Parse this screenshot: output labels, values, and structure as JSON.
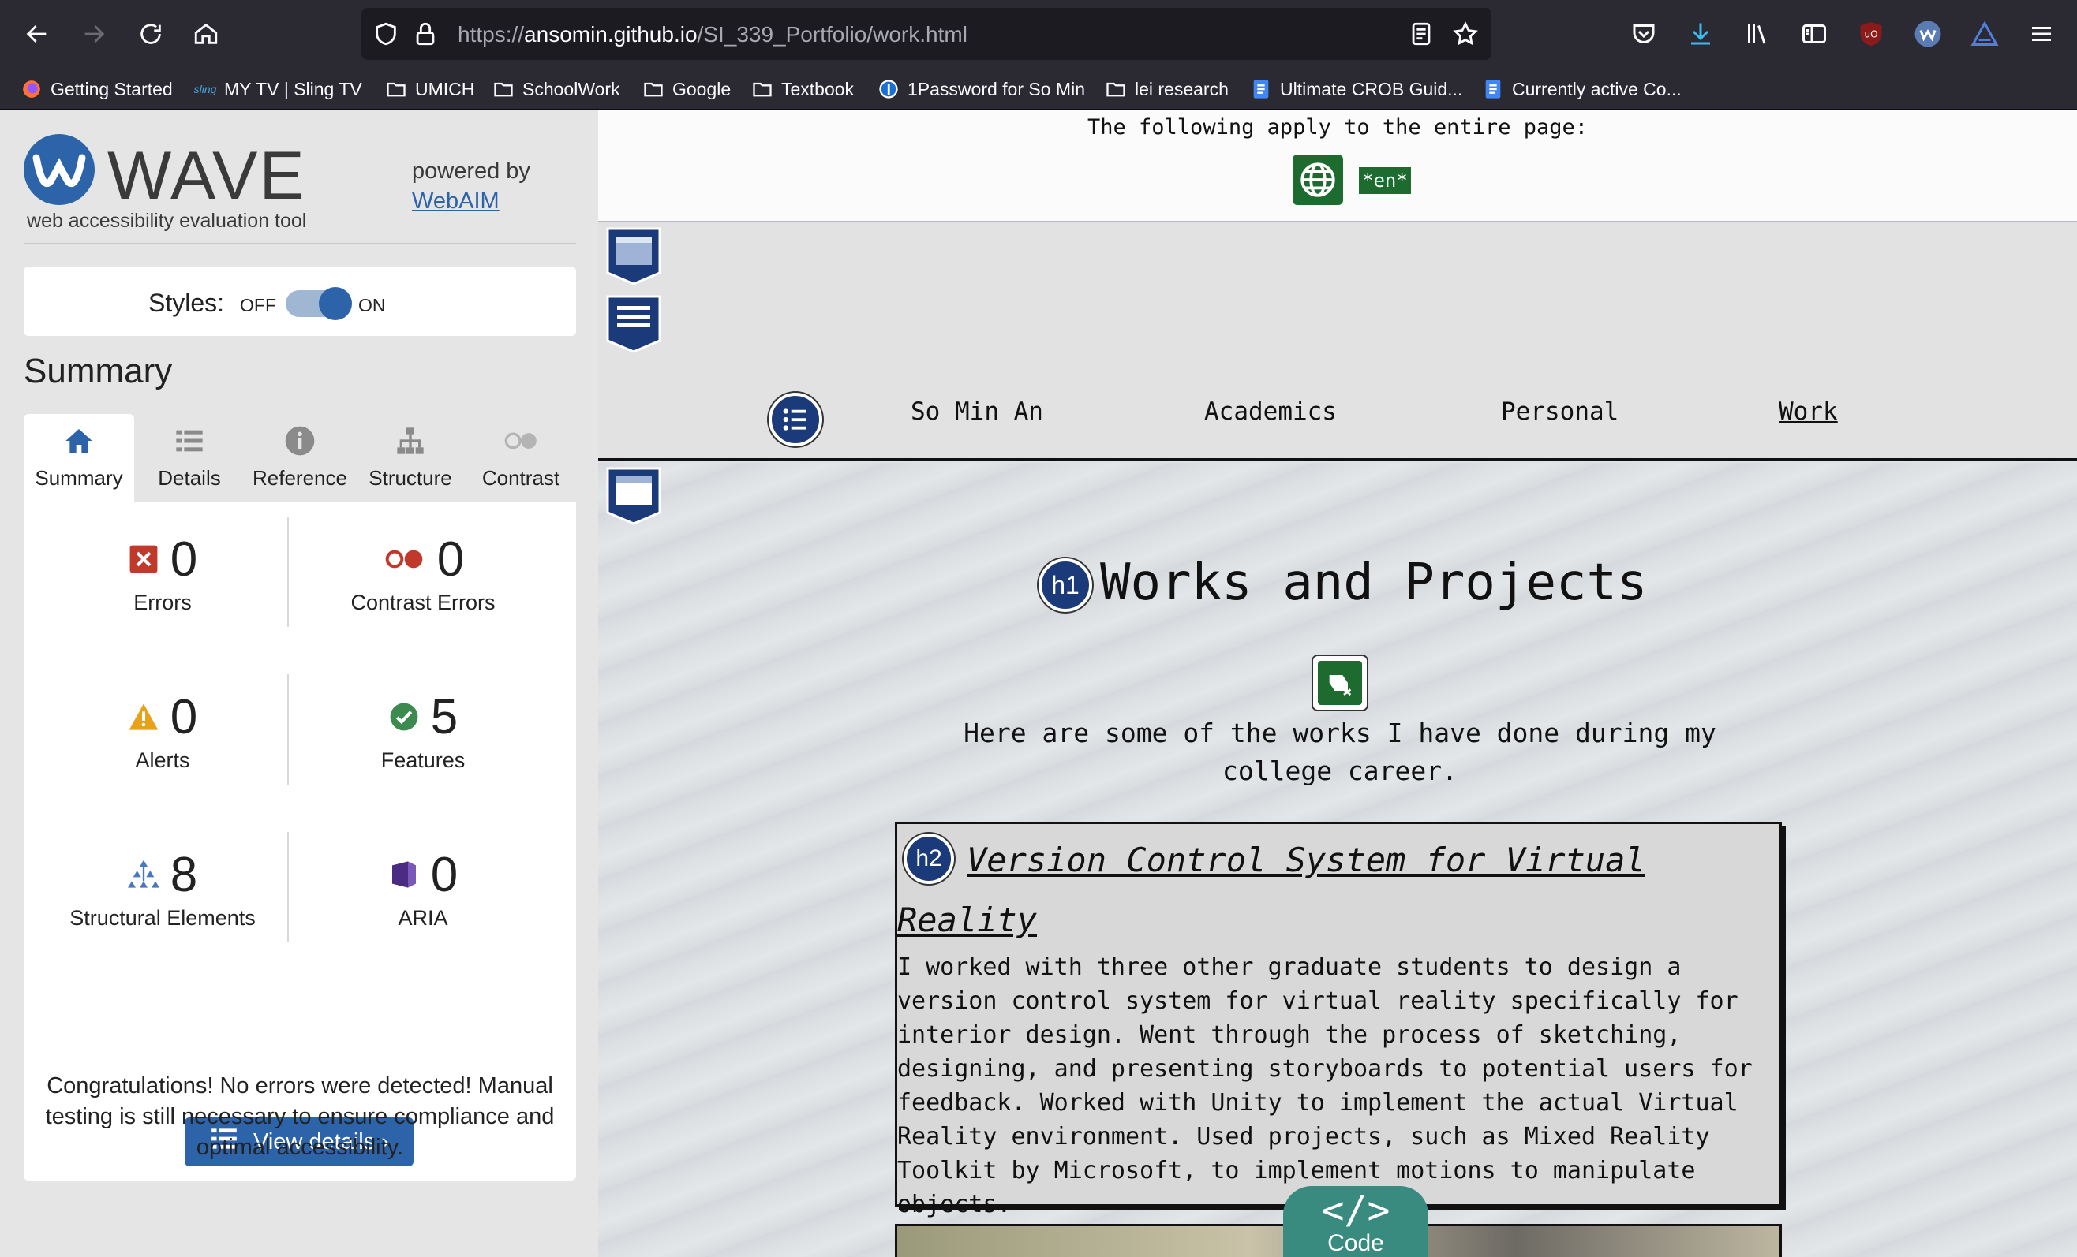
{
  "browser": {
    "url_prefix": "https://",
    "url_host": "ansomin.github.io",
    "url_path": "/SI_339_Portfolio/work.html",
    "bookmarks": [
      {
        "label": "Getting Started",
        "icon": "firefox-icon"
      },
      {
        "label": "MY TV | Sling TV",
        "icon": "sling-icon"
      },
      {
        "label": "UMICH",
        "icon": "folder-icon"
      },
      {
        "label": "SchoolWork",
        "icon": "folder-icon"
      },
      {
        "label": "Google",
        "icon": "folder-icon"
      },
      {
        "label": "Textbook",
        "icon": "folder-icon"
      },
      {
        "label": "1Password for So Min",
        "icon": "1password-icon"
      },
      {
        "label": "lei research",
        "icon": "folder-icon"
      },
      {
        "label": "Ultimate CROB Guid...",
        "icon": "doc-icon"
      },
      {
        "label": "Currently active Co...",
        "icon": "doc-icon"
      }
    ]
  },
  "wave": {
    "title": "WAVE",
    "subtitle": "web accessibility evaluation tool",
    "powered_by": "powered by",
    "powered_link": "WebAIM",
    "styles_label": "Styles:",
    "styles_off": "OFF",
    "styles_on": "ON",
    "summary_heading": "Summary",
    "tabs": [
      {
        "label": "Summary",
        "icon": "home-icon"
      },
      {
        "label": "Details",
        "icon": "list-icon"
      },
      {
        "label": "Reference",
        "icon": "info-icon"
      },
      {
        "label": "Structure",
        "icon": "hierarchy-icon"
      },
      {
        "label": "Contrast",
        "icon": "contrast-icon"
      }
    ],
    "stats": {
      "errors": {
        "count": "0",
        "label": "Errors"
      },
      "contrast_errors": {
        "count": "0",
        "label": "Contrast Errors"
      },
      "alerts": {
        "count": "0",
        "label": "Alerts"
      },
      "features": {
        "count": "5",
        "label": "Features"
      },
      "structural": {
        "count": "8",
        "label": "Structural Elements"
      },
      "aria": {
        "count": "0",
        "label": "ARIA"
      }
    },
    "view_details": "View details ›",
    "congrats": "Congratulations! No errors were detected! Manual testing is still necessary to ensure compliance and optimal accessibility.",
    "colors": {
      "brand": "#2c63a9",
      "error": "#c0392b",
      "alert": "#e8a21a",
      "feature": "#3c8a4d",
      "aria": "#4b2c83"
    }
  },
  "page": {
    "apply_text": "The following apply to the entire page:",
    "lang_badge": "*en*",
    "nav": [
      "So Min An",
      "Academics",
      "Personal",
      "Work"
    ],
    "h1_badge": "h1",
    "h1": "Works and Projects",
    "intro": "Here are some of the works I have done during my college career.",
    "h2_badge": "h2",
    "project_title": "Version Control System for Virtual Reality",
    "project_desc": "I worked with three other graduate students to design a version control system for virtual reality specifically for interior design. Went through the process of sketching, designing, and presenting storyboards to potential users for feedback. Worked with Unity to implement the actual Virtual Reality environment. Used projects, such as Mixed Reality Toolkit by Microsoft, to implement motions to manipulate objects.",
    "code_symbol": "</>",
    "code_label": "Code"
  }
}
